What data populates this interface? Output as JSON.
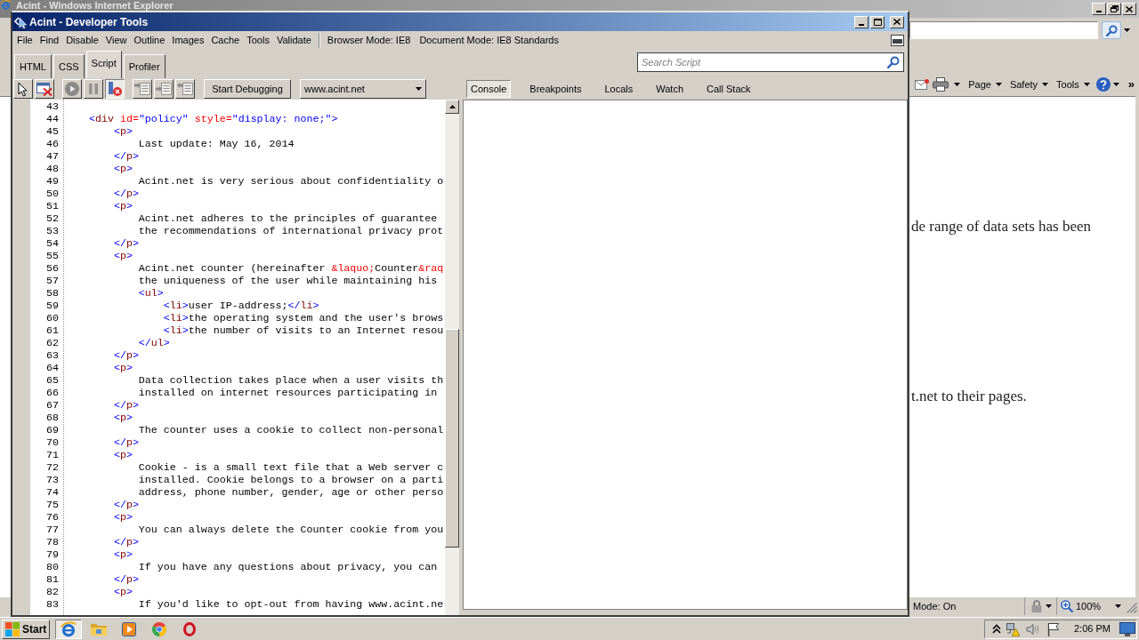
{
  "browser": {
    "title": "Acint - Windows Internet Explorer",
    "command_bar": {
      "menus": [
        "Page",
        "Safety",
        "Tools"
      ],
      "overflow": "»"
    },
    "page_text": [
      "de range of data sets has been",
      "t.net to their pages."
    ],
    "status_bar": {
      "mode": "Mode: On",
      "zoom": "100%"
    }
  },
  "devtools": {
    "title": "Acint - Developer Tools",
    "menu": [
      "File",
      "Find",
      "Disable",
      "View",
      "Outline",
      "Images",
      "Cache",
      "Tools",
      "Validate"
    ],
    "modes": [
      "Browser Mode: IE8",
      "Document Mode: IE8 Standards"
    ],
    "tabs": [
      {
        "label": "HTML",
        "selected": false
      },
      {
        "label": "CSS",
        "selected": false
      },
      {
        "label": "Script",
        "selected": true
      },
      {
        "label": "Profiler",
        "selected": false
      }
    ],
    "search": {
      "placeholder": "Search Script"
    },
    "toolbar": {
      "icon_buttons": [
        {
          "pressed": false,
          "disabled": false
        },
        {
          "pressed": false,
          "disabled": false
        },
        {
          "pressed": false,
          "disabled": true
        },
        {
          "pressed": false,
          "disabled": true
        },
        {
          "pressed": true,
          "disabled": false
        },
        {
          "pressed": false,
          "disabled": true
        },
        {
          "pressed": false,
          "disabled": true
        },
        {
          "pressed": false,
          "disabled": true
        }
      ],
      "start_button": "Start Debugging",
      "source": "www.acint.net"
    },
    "pane_tabs": [
      {
        "label": "Console",
        "selected": true
      },
      {
        "label": "Breakpoints",
        "selected": false
      },
      {
        "label": "Locals",
        "selected": false
      },
      {
        "label": "Watch",
        "selected": false
      },
      {
        "label": "Call Stack",
        "selected": false
      }
    ],
    "code": [
      {
        "number": "43"
      },
      {
        "number": "44",
        "tokens": [
          {
            "kind": "bracket",
            "text": "    <"
          },
          {
            "kind": "tag",
            "text": "div"
          },
          {
            "kind": "attr",
            "text": " id="
          },
          {
            "kind": "value",
            "text": "\"policy\""
          },
          {
            "kind": "attr",
            "text": " style="
          },
          {
            "kind": "value",
            "text": "\"display: none;\""
          },
          {
            "kind": "bracket",
            "text": ">"
          }
        ]
      },
      {
        "number": "45",
        "tokens": [
          {
            "kind": "bracket",
            "text": "        <"
          },
          {
            "kind": "tag",
            "text": "p"
          },
          {
            "kind": "bracket",
            "text": ">"
          }
        ]
      },
      {
        "number": "46",
        "tokens": [
          {
            "kind": "text",
            "text": "            Last update: May 16, 2014"
          }
        ]
      },
      {
        "number": "47",
        "tokens": [
          {
            "kind": "bracket",
            "text": "        </"
          },
          {
            "kind": "tag",
            "text": "p"
          },
          {
            "kind": "bracket",
            "text": ">"
          }
        ]
      },
      {
        "number": "48",
        "tokens": [
          {
            "kind": "bracket",
            "text": "        <"
          },
          {
            "kind": "tag",
            "text": "p"
          },
          {
            "kind": "bracket",
            "text": ">"
          }
        ]
      },
      {
        "number": "49",
        "tokens": [
          {
            "kind": "text",
            "text": "            Acint.net is very serious about confidentiality o"
          }
        ]
      },
      {
        "number": "50",
        "tokens": [
          {
            "kind": "bracket",
            "text": "        </"
          },
          {
            "kind": "tag",
            "text": "p"
          },
          {
            "kind": "bracket",
            "text": ">"
          }
        ]
      },
      {
        "number": "51",
        "tokens": [
          {
            "kind": "bracket",
            "text": "        <"
          },
          {
            "kind": "tag",
            "text": "p"
          },
          {
            "kind": "bracket",
            "text": ">"
          }
        ]
      },
      {
        "number": "52",
        "tokens": [
          {
            "kind": "text",
            "text": "            Acint.net adheres to the principles of guarantee"
          }
        ]
      },
      {
        "number": "53",
        "tokens": [
          {
            "kind": "text",
            "text": "            the recommendations of international privacy prot"
          }
        ]
      },
      {
        "number": "54",
        "tokens": [
          {
            "kind": "bracket",
            "text": "        </"
          },
          {
            "kind": "tag",
            "text": "p"
          },
          {
            "kind": "bracket",
            "text": ">"
          }
        ]
      },
      {
        "number": "55",
        "tokens": [
          {
            "kind": "bracket",
            "text": "        <"
          },
          {
            "kind": "tag",
            "text": "p"
          },
          {
            "kind": "bracket",
            "text": ">"
          }
        ]
      },
      {
        "number": "56",
        "tokens": [
          {
            "kind": "text",
            "text": "            Acint.net counter (hereinafter "
          },
          {
            "kind": "entity",
            "text": "&laquo;"
          },
          {
            "kind": "text",
            "text": "Counter"
          },
          {
            "kind": "entity",
            "text": "&raq"
          }
        ]
      },
      {
        "number": "57",
        "tokens": [
          {
            "kind": "text",
            "text": "            the uniqueness of the user while maintaining his"
          }
        ]
      },
      {
        "number": "58",
        "tokens": [
          {
            "kind": "bracket",
            "text": "            <"
          },
          {
            "kind": "tag",
            "text": "ul"
          },
          {
            "kind": "bracket",
            "text": ">"
          }
        ]
      },
      {
        "number": "59",
        "tokens": [
          {
            "kind": "bracket",
            "text": "                <"
          },
          {
            "kind": "tag",
            "text": "li"
          },
          {
            "kind": "bracket",
            "text": ">"
          },
          {
            "kind": "text",
            "text": "user IP-address;"
          },
          {
            "kind": "bracket",
            "text": "</"
          },
          {
            "kind": "tag",
            "text": "li"
          },
          {
            "kind": "bracket",
            "text": ">"
          }
        ]
      },
      {
        "number": "60",
        "tokens": [
          {
            "kind": "bracket",
            "text": "                <"
          },
          {
            "kind": "tag",
            "text": "li"
          },
          {
            "kind": "bracket",
            "text": ">"
          },
          {
            "kind": "text",
            "text": "the operating system and the user's brows"
          }
        ]
      },
      {
        "number": "61",
        "tokens": [
          {
            "kind": "bracket",
            "text": "                <"
          },
          {
            "kind": "tag",
            "text": "li"
          },
          {
            "kind": "bracket",
            "text": ">"
          },
          {
            "kind": "text",
            "text": "the number of visits to an Internet resou"
          }
        ]
      },
      {
        "number": "62",
        "tokens": [
          {
            "kind": "bracket",
            "text": "            </"
          },
          {
            "kind": "tag",
            "text": "ul"
          },
          {
            "kind": "bracket",
            "text": ">"
          }
        ]
      },
      {
        "number": "63",
        "tokens": [
          {
            "kind": "bracket",
            "text": "        </"
          },
          {
            "kind": "tag",
            "text": "p"
          },
          {
            "kind": "bracket",
            "text": ">"
          }
        ]
      },
      {
        "number": "64",
        "tokens": [
          {
            "kind": "bracket",
            "text": "        <"
          },
          {
            "kind": "tag",
            "text": "p"
          },
          {
            "kind": "bracket",
            "text": ">"
          }
        ]
      },
      {
        "number": "65",
        "tokens": [
          {
            "kind": "text",
            "text": "            Data collection takes place when a user visits th"
          }
        ]
      },
      {
        "number": "66",
        "tokens": [
          {
            "kind": "text",
            "text": "            installed on internet resources participating in"
          }
        ]
      },
      {
        "number": "67",
        "tokens": [
          {
            "kind": "bracket",
            "text": "        </"
          },
          {
            "kind": "tag",
            "text": "p"
          },
          {
            "kind": "bracket",
            "text": ">"
          }
        ]
      },
      {
        "number": "68",
        "tokens": [
          {
            "kind": "bracket",
            "text": "        <"
          },
          {
            "kind": "tag",
            "text": "p"
          },
          {
            "kind": "bracket",
            "text": ">"
          }
        ]
      },
      {
        "number": "69",
        "tokens": [
          {
            "kind": "text",
            "text": "            The counter uses a cookie to collect non-personal"
          }
        ]
      },
      {
        "number": "70",
        "tokens": [
          {
            "kind": "bracket",
            "text": "        </"
          },
          {
            "kind": "tag",
            "text": "p"
          },
          {
            "kind": "bracket",
            "text": ">"
          }
        ]
      },
      {
        "number": "71",
        "tokens": [
          {
            "kind": "bracket",
            "text": "        <"
          },
          {
            "kind": "tag",
            "text": "p"
          },
          {
            "kind": "bracket",
            "text": ">"
          }
        ]
      },
      {
        "number": "72",
        "tokens": [
          {
            "kind": "text",
            "text": "            Cookie - is a small text file that a Web server c"
          }
        ]
      },
      {
        "number": "73",
        "tokens": [
          {
            "kind": "text",
            "text": "            installed. Cookie belongs to a browser on a parti"
          }
        ]
      },
      {
        "number": "74",
        "tokens": [
          {
            "kind": "text",
            "text": "            address, phone number, gender, age or other perso"
          }
        ]
      },
      {
        "number": "75",
        "tokens": [
          {
            "kind": "bracket",
            "text": "        </"
          },
          {
            "kind": "tag",
            "text": "p"
          },
          {
            "kind": "bracket",
            "text": ">"
          }
        ]
      },
      {
        "number": "76",
        "tokens": [
          {
            "kind": "bracket",
            "text": "        <"
          },
          {
            "kind": "tag",
            "text": "p"
          },
          {
            "kind": "bracket",
            "text": ">"
          }
        ]
      },
      {
        "number": "77",
        "tokens": [
          {
            "kind": "text",
            "text": "            You can always delete the Counter cookie from you"
          }
        ]
      },
      {
        "number": "78",
        "tokens": [
          {
            "kind": "bracket",
            "text": "        </"
          },
          {
            "kind": "tag",
            "text": "p"
          },
          {
            "kind": "bracket",
            "text": ">"
          }
        ]
      },
      {
        "number": "79",
        "tokens": [
          {
            "kind": "bracket",
            "text": "        <"
          },
          {
            "kind": "tag",
            "text": "p"
          },
          {
            "kind": "bracket",
            "text": ">"
          }
        ]
      },
      {
        "number": "80",
        "tokens": [
          {
            "kind": "text",
            "text": "            If you have any questions about privacy, you can"
          }
        ]
      },
      {
        "number": "81",
        "tokens": [
          {
            "kind": "bracket",
            "text": "        </"
          },
          {
            "kind": "tag",
            "text": "p"
          },
          {
            "kind": "bracket",
            "text": ">"
          }
        ]
      },
      {
        "number": "82",
        "tokens": [
          {
            "kind": "bracket",
            "text": "        <"
          },
          {
            "kind": "tag",
            "text": "p"
          },
          {
            "kind": "bracket",
            "text": ">"
          }
        ]
      },
      {
        "number": "83",
        "tokens": [
          {
            "kind": "text",
            "text": "            If you'd like to opt-out from having www.acint.ne"
          }
        ]
      }
    ]
  },
  "taskbar": {
    "start": "Start",
    "apps": [
      {
        "selected": true
      },
      {
        "selected": false
      },
      {
        "selected": false
      },
      {
        "selected": false
      },
      {
        "selected": false
      }
    ],
    "clock": "2:06 PM"
  }
}
